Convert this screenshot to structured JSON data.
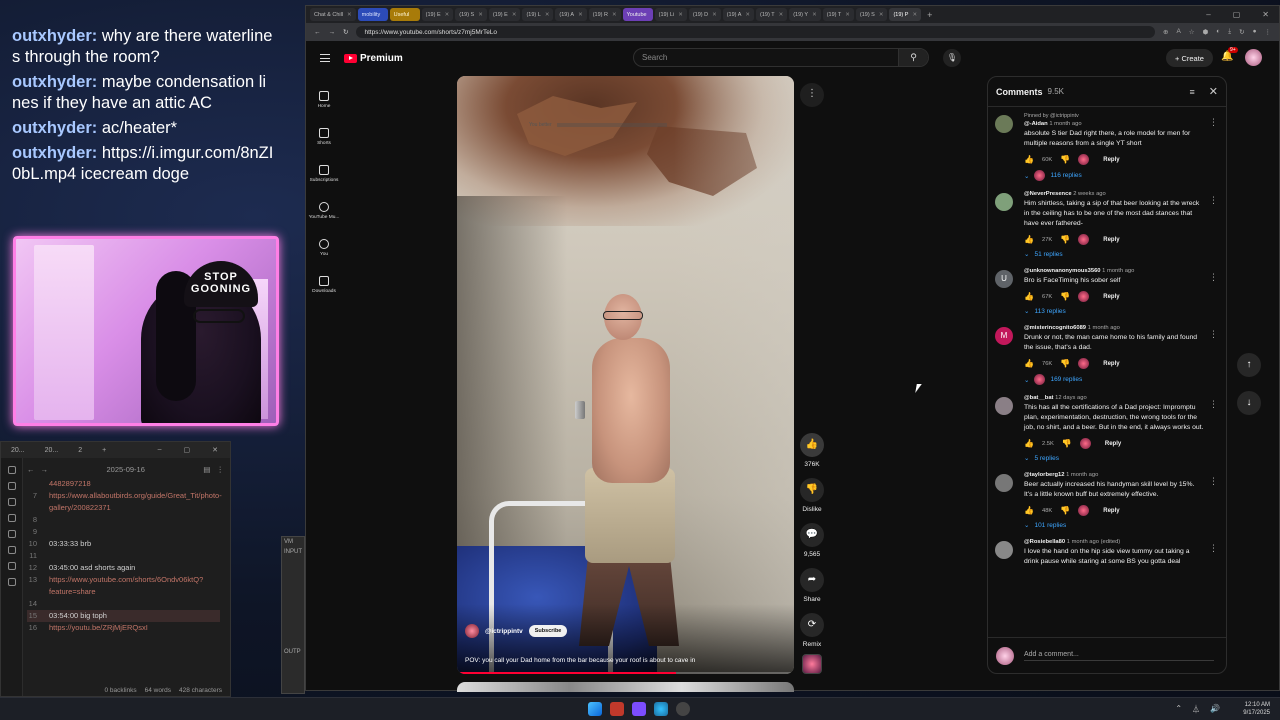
{
  "chat": {
    "messages": [
      {
        "user": "outxhyder:",
        "text": "why are there waterlines through the room?"
      },
      {
        "user": "outxhyder:",
        "text": "maybe condensation lines if they have an attic AC"
      },
      {
        "user": "outxhyder:",
        "text": "ac/heater*"
      },
      {
        "user": "outxhyder:",
        "text": "https://i.imgur.com/8nZI0bL.mp4 icecream doge"
      }
    ]
  },
  "webcam": {
    "hat_text": "STOP GOONING"
  },
  "notes": {
    "tabs": [
      "20...",
      "20...",
      "2"
    ],
    "date": "2025-09-16",
    "lines": [
      {
        "n": "",
        "text": "4482897218",
        "link": true
      },
      {
        "n": "7",
        "text": "https://www.allaboutbirds.org/guide/Great_Tit/photo-gallery/200822371",
        "link": true
      },
      {
        "n": "8",
        "text": "",
        "link": false
      },
      {
        "n": "9",
        "text": "",
        "link": false
      },
      {
        "n": "10",
        "text": "03:33:33 brb",
        "link": false
      },
      {
        "n": "11",
        "text": "",
        "link": false
      },
      {
        "n": "12",
        "text": "03:45:00 asd shorts again",
        "link": false
      },
      {
        "n": "13",
        "text": "https://www.youtube.com/shorts/6Ondv06ktQ?feature=share",
        "link": true
      },
      {
        "n": "14",
        "text": "",
        "link": false
      },
      {
        "n": "15",
        "text": "03:54:00 big toph",
        "link": false
      },
      {
        "n": "16",
        "text": "https://youtu.be/ZRjMjERQsxI",
        "link": true
      }
    ],
    "status": {
      "backlinks": "0 backlinks",
      "words": "64 words",
      "chars": "428 characters"
    }
  },
  "sidepanel": {
    "title": "VM",
    "input": "INPUT",
    "output": "OUTP"
  },
  "browser": {
    "tabs": [
      {
        "label": "Chat & Chill",
        "style": ""
      },
      {
        "label": "mobility",
        "style": "group-blue"
      },
      {
        "label": "Useful",
        "style": "group-yellow"
      },
      {
        "label": "(19) E",
        "style": ""
      },
      {
        "label": "(19) S",
        "style": ""
      },
      {
        "label": "(19) E",
        "style": ""
      },
      {
        "label": "(19) L",
        "style": ""
      },
      {
        "label": "(19) A",
        "style": ""
      },
      {
        "label": "(19) R",
        "style": ""
      },
      {
        "label": "Youtube",
        "style": "group-purple"
      },
      {
        "label": "(19) Li",
        "style": ""
      },
      {
        "label": "(19) D",
        "style": ""
      },
      {
        "label": "(19) A",
        "style": ""
      },
      {
        "label": "(19) T",
        "style": ""
      },
      {
        "label": "(19) Y",
        "style": ""
      },
      {
        "label": "(19) T",
        "style": ""
      },
      {
        "label": "(19) S",
        "style": ""
      },
      {
        "label": "(19) P",
        "style": "active"
      }
    ],
    "url": "https://www.youtube.com/shorts/z7mj5MrTeLo"
  },
  "youtube": {
    "logo_text": "Premium",
    "search_placeholder": "Search",
    "create_label": "+ Create",
    "bell_badge": "9+",
    "nav": [
      {
        "label": "Home",
        "icon": "home-icon"
      },
      {
        "label": "Shorts",
        "icon": "shorts-icon"
      },
      {
        "label": "Subscriptions",
        "icon": "subscriptions-icon"
      },
      {
        "label": "YouTube Mu...",
        "icon": "youtube-music-icon"
      },
      {
        "label": "You",
        "icon": "you-icon"
      },
      {
        "label": "Downloads",
        "icon": "downloads-icon"
      }
    ],
    "video": {
      "hint": "You better",
      "channel": "@ictrippintv",
      "subscribe": "Subscribe",
      "caption": "POV: you call your Dad home from the bar because your roof is about to cave in",
      "progress": 0.65
    },
    "actions": [
      {
        "icon": "like-icon",
        "glyph": "👍",
        "label": "376K"
      },
      {
        "icon": "dislike-icon",
        "glyph": "👎",
        "label": "Dislike"
      },
      {
        "icon": "comments-icon",
        "glyph": "💬",
        "label": "9,565"
      },
      {
        "icon": "share-icon",
        "glyph": "➦",
        "label": "Share"
      },
      {
        "icon": "remix-icon",
        "glyph": "⟳",
        "label": "Remix"
      }
    ]
  },
  "comments": {
    "title": "Comments",
    "count": "9.5K",
    "add_placeholder": "Add a comment...",
    "items": [
      {
        "pinned": "Pinned by @ictrippintv",
        "author": "@-Aidan",
        "time": "1 month ago",
        "text": "absolute S tier Dad right there, a role model for men for multiple reasons from a single YT short",
        "likes": "60K",
        "replies": "116 replies",
        "avatar_color": "#6b7a58",
        "initial": ""
      },
      {
        "pinned": "",
        "author": "@NeverPresence",
        "time": "2 weeks ago",
        "text": "Him shirtless, taking a sip of that beer looking at the wreck in the ceiling has to be one of the most dad stances that have ever fathered-",
        "likes": "27K",
        "replies": "51 replies",
        "avatar_color": "#7fa07a",
        "initial": ""
      },
      {
        "pinned": "",
        "author": "@unknownanonymous3560",
        "time": "1 month ago",
        "text": "Bro is FaceTiming his sober self",
        "likes": "67K",
        "replies": "113 replies",
        "avatar_color": "#5f6368",
        "initial": "U"
      },
      {
        "pinned": "",
        "author": "@misterincognito6089",
        "time": "1 month ago",
        "text": "Drunk or not, the man came home to his family and found the issue, that's a dad.",
        "likes": "76K",
        "replies": "169 replies",
        "avatar_color": "#c2185b",
        "initial": "M"
      },
      {
        "pinned": "",
        "author": "@bat__bat",
        "time": "12 days ago",
        "text": "This has all the certifications of a Dad project: Impromptu plan, experimentation, destruction, the wrong tools for the job, no shirt, and a beer. But in the end, it always works out.",
        "likes": "2.5K",
        "replies": "5 replies",
        "avatar_color": "#8a7f86",
        "initial": ""
      },
      {
        "pinned": "",
        "author": "@taylorberg12",
        "time": "1 month ago",
        "text": "Beer actually increased his handyman skill level by 15%. It's a little known buff but extremely effective.",
        "likes": "48K",
        "replies": "101 replies",
        "avatar_color": "#777",
        "initial": ""
      },
      {
        "pinned": "",
        "author": "@Rosiebella80",
        "time": "1 month ago (edited)",
        "text": "I love the hand on the hip side view tummy out taking a drink pause while staring at some BS you gotta deal",
        "likes": "",
        "replies": "",
        "avatar_color": "#888",
        "initial": ""
      }
    ]
  },
  "taskbar": {
    "time": "12:10 AM",
    "date": "9/17/2025"
  },
  "colors": {
    "accent": "#ff0033",
    "link": "#3ea6ff",
    "webcam_border": "#ff7fe6"
  }
}
